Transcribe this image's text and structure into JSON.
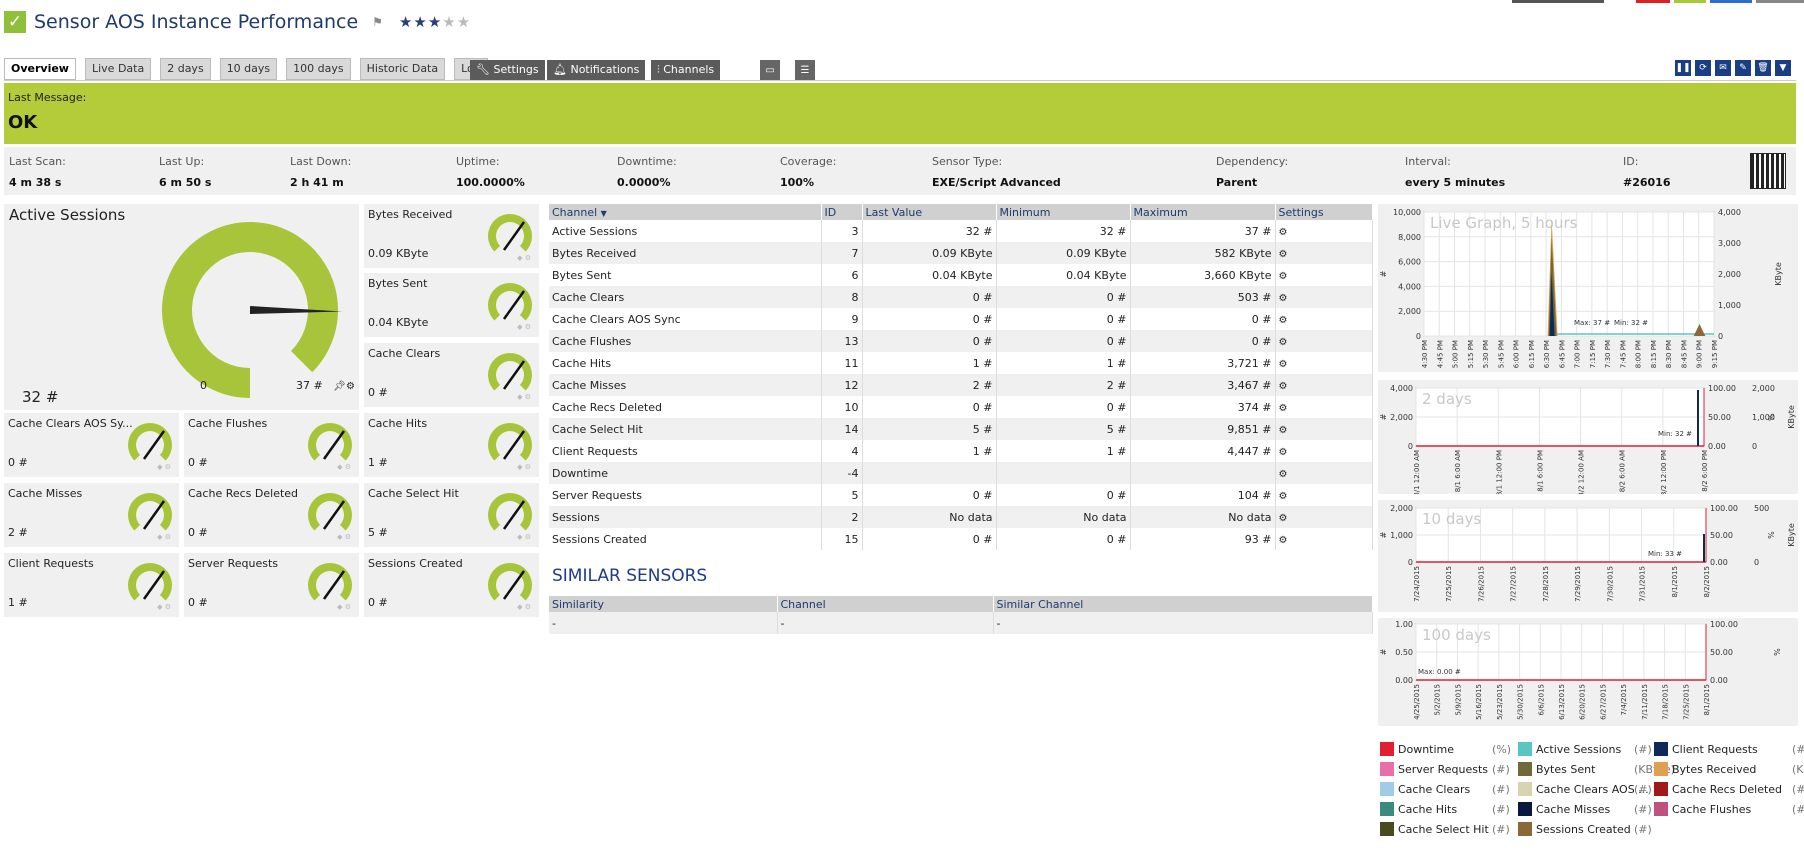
{
  "header": {
    "title": "Sensor AOS Instance Performance",
    "flag_icon": "flag-icon",
    "stars": {
      "rating": 3,
      "max": 5
    }
  },
  "top_color_bar": [
    "#555555",
    "#e02020",
    "#a8c83a",
    "#2a6ed0",
    "#888888"
  ],
  "tabs": [
    {
      "label": "Overview",
      "active": true
    },
    {
      "label": "Live Data"
    },
    {
      "label": "2 days"
    },
    {
      "label": "10 days"
    },
    {
      "label": "100 days"
    },
    {
      "label": "Historic Data"
    },
    {
      "label": "Log"
    }
  ],
  "toolbar": {
    "settings": "Settings",
    "notifications": "Notifications",
    "channels": "Channels"
  },
  "message": {
    "label": "Last Message:",
    "value": "OK",
    "color": "#b4cc3a"
  },
  "info": [
    {
      "label": "Last Scan:",
      "value": "4 m 38 s"
    },
    {
      "label": "Last Up:",
      "value": "6 m 50 s"
    },
    {
      "label": "Last Down:",
      "value": "2 h 41 m"
    },
    {
      "label": "Uptime:",
      "value": "100.0000%"
    },
    {
      "label": "Downtime:",
      "value": "0.0000%"
    },
    {
      "label": "Coverage:",
      "value": "100%"
    },
    {
      "label": "Sensor Type:",
      "value": "EXE/Script Advanced"
    },
    {
      "label": "Dependency:",
      "value": "Parent"
    },
    {
      "label": "Interval:",
      "value": "every 5 minutes"
    },
    {
      "label": "ID:",
      "value": "#26016"
    }
  ],
  "primary_gauge": {
    "name": "Active Sessions",
    "value": "32 #",
    "min_label": "0",
    "max_label": "37 #",
    "fraction": 0.86
  },
  "gauges": [
    {
      "name": "Bytes Received",
      "value": "0.09 KByte"
    },
    {
      "name": "Bytes Sent",
      "value": "0.04 KByte"
    },
    {
      "name": "Cache Clears",
      "value": "0 #"
    },
    {
      "name": "Cache Clears AOS Sy...",
      "value": "0 #"
    },
    {
      "name": "Cache Flushes",
      "value": "0 #"
    },
    {
      "name": "Cache Hits",
      "value": "1 #"
    },
    {
      "name": "Cache Misses",
      "value": "2 #"
    },
    {
      "name": "Cache Recs Deleted",
      "value": "0 #"
    },
    {
      "name": "Cache Select Hit",
      "value": "5 #"
    },
    {
      "name": "Client Requests",
      "value": "1 #"
    },
    {
      "name": "Server Requests",
      "value": "0 #"
    },
    {
      "name": "Sessions Created",
      "value": "0 #"
    }
  ],
  "channel_table": {
    "headers": [
      "Channel",
      "ID",
      "Last Value",
      "Minimum",
      "Maximum",
      "Settings"
    ],
    "rows": [
      [
        "Active Sessions",
        "3",
        "32 #",
        "32 #",
        "37 #"
      ],
      [
        "Bytes Received",
        "7",
        "0.09 KByte",
        "0.09 KByte",
        "582 KByte"
      ],
      [
        "Bytes Sent",
        "6",
        "0.04 KByte",
        "0.04 KByte",
        "3,660 KByte"
      ],
      [
        "Cache Clears",
        "8",
        "0 #",
        "0 #",
        "503 #"
      ],
      [
        "Cache Clears AOS Sync",
        "9",
        "0 #",
        "0 #",
        "0 #"
      ],
      [
        "Cache Flushes",
        "13",
        "0 #",
        "0 #",
        "0 #"
      ],
      [
        "Cache Hits",
        "11",
        "1 #",
        "1 #",
        "3,721 #"
      ],
      [
        "Cache Misses",
        "12",
        "2 #",
        "2 #",
        "3,467 #"
      ],
      [
        "Cache Recs Deleted",
        "10",
        "0 #",
        "0 #",
        "374 #"
      ],
      [
        "Cache Select Hit",
        "14",
        "5 #",
        "5 #",
        "9,851 #"
      ],
      [
        "Client Requests",
        "4",
        "1 #",
        "1 #",
        "4,447 #"
      ],
      [
        "Downtime",
        "-4",
        "",
        "",
        ""
      ],
      [
        "Server Requests",
        "5",
        "0 #",
        "0 #",
        "104 #"
      ],
      [
        "Sessions",
        "2",
        "No data",
        "No data",
        "No data"
      ],
      [
        "Sessions Created",
        "15",
        "0 #",
        "0 #",
        "93 #"
      ]
    ]
  },
  "similar": {
    "title": "SIMILAR SENSORS",
    "headers": [
      "Similarity",
      "Channel",
      "Similar Channel"
    ],
    "row": [
      "-",
      "-",
      "-"
    ]
  },
  "graphs": {
    "live": {
      "title": "Live Graph, 5 hours",
      "left_ticks": [
        "10,000",
        "8,000",
        "6,000",
        "4,000",
        "2,000",
        "0"
      ],
      "right_ticks": [
        "4,000",
        "3,000",
        "2,000",
        "1,000",
        "0"
      ],
      "x_ticks": [
        "4:30 PM",
        "4:45 PM",
        "5:00 PM",
        "5:15 PM",
        "5:30 PM",
        "5:45 PM",
        "6:00 PM",
        "6:15 PM",
        "6:30 PM",
        "6:45 PM",
        "7:00 PM",
        "7:15 PM",
        "7:30 PM",
        "7:45 PM",
        "8:00 PM",
        "8:15 PM",
        "8:30 PM",
        "8:45 PM",
        "9:00 PM",
        "9:15 PM"
      ],
      "left_unit": "#",
      "right_unit": "KByte",
      "annotations": [
        "Max: 37 #",
        "Min: 32 #"
      ]
    },
    "two_days": {
      "title": "2 days",
      "left_ticks": [
        "4,000",
        "2,000",
        "0"
      ],
      "right_ticks": [
        "100.00",
        "50.00",
        "0.00"
      ],
      "right2_ticks": [
        "2,000",
        "1,000",
        "0"
      ],
      "x_ticks": [
        "8/1 12:00 AM",
        "8/1 6:00 AM",
        "8/1 12:00 PM",
        "8/1 6:00 PM",
        "8/2 12:00 AM",
        "8/2 6:00 AM",
        "8/2 12:00 PM",
        "8/2 6:00 PM"
      ],
      "left_unit": "#",
      "right_unit": "%",
      "right2_unit": "KByte",
      "annotations": [
        "Min: 32 #"
      ]
    },
    "ten_days": {
      "title": "10 days",
      "left_ticks": [
        "2,000",
        "1,000",
        "0"
      ],
      "right_ticks": [
        "100.00",
        "50.00",
        "0.00"
      ],
      "right2_ticks": [
        "500",
        "0"
      ],
      "x_ticks": [
        "7/24/2015",
        "7/25/2015",
        "7/26/2015",
        "7/27/2015",
        "7/28/2015",
        "7/29/2015",
        "7/30/2015",
        "7/31/2015",
        "8/1/2015",
        "8/2/2015"
      ],
      "left_unit": "#",
      "right_unit": "%",
      "right2_unit": "KByte",
      "annotations": [
        "Min: 33 #"
      ]
    },
    "hundred_days": {
      "title": "100 days",
      "left_ticks": [
        "1.00",
        "0.50",
        "0.00"
      ],
      "right_ticks": [
        "100.00",
        "50.00",
        "0.00"
      ],
      "x_ticks": [
        "4/25/2015",
        "5/2/2015",
        "5/9/2015",
        "5/16/2015",
        "5/23/2015",
        "5/30/2015",
        "6/6/2015",
        "6/13/2015",
        "6/20/2015",
        "6/27/2015",
        "7/4/2015",
        "7/11/2015",
        "7/18/2015",
        "7/25/2015",
        "8/1/2015"
      ],
      "left_unit": "#",
      "right_unit": "%",
      "annotations": [
        "Max: 0.00 #"
      ]
    }
  },
  "legend": [
    {
      "name": "Downtime",
      "unit": "(%)",
      "color": "#e02030"
    },
    {
      "name": "Active Sessions",
      "unit": "(#)",
      "color": "#5bc4c4"
    },
    {
      "name": "Client Requests",
      "unit": "(#)",
      "color": "#0e2a5a"
    },
    {
      "name": "Server Requests",
      "unit": "(#)",
      "color": "#e870a8"
    },
    {
      "name": "Bytes Sent",
      "unit": "(KByte)",
      "color": "#6e6a3a"
    },
    {
      "name": "Bytes Received",
      "unit": "(KByte)",
      "color": "#e0a050"
    },
    {
      "name": "Cache Clears",
      "unit": "(#)",
      "color": "#a0cce8"
    },
    {
      "name": "Cache Clears AOS ...",
      "unit": "(#)",
      "color": "#d8d4b0"
    },
    {
      "name": "Cache Recs Deleted",
      "unit": "(#)",
      "color": "#a01818"
    },
    {
      "name": "Cache Hits",
      "unit": "(#)",
      "color": "#3a8a80"
    },
    {
      "name": "Cache Misses",
      "unit": "(#)",
      "color": "#081840"
    },
    {
      "name": "Cache Flushes",
      "unit": "(#)",
      "color": "#c05080"
    },
    {
      "name": "Cache Select Hit",
      "unit": "(#)",
      "color": "#4a4a20"
    },
    {
      "name": "Sessions Created",
      "unit": "(#)",
      "color": "#8a6838"
    }
  ],
  "colors": {
    "gauge": "#a8c43a",
    "accent": "#1f3a6b",
    "ok": "#b4cc3a"
  }
}
